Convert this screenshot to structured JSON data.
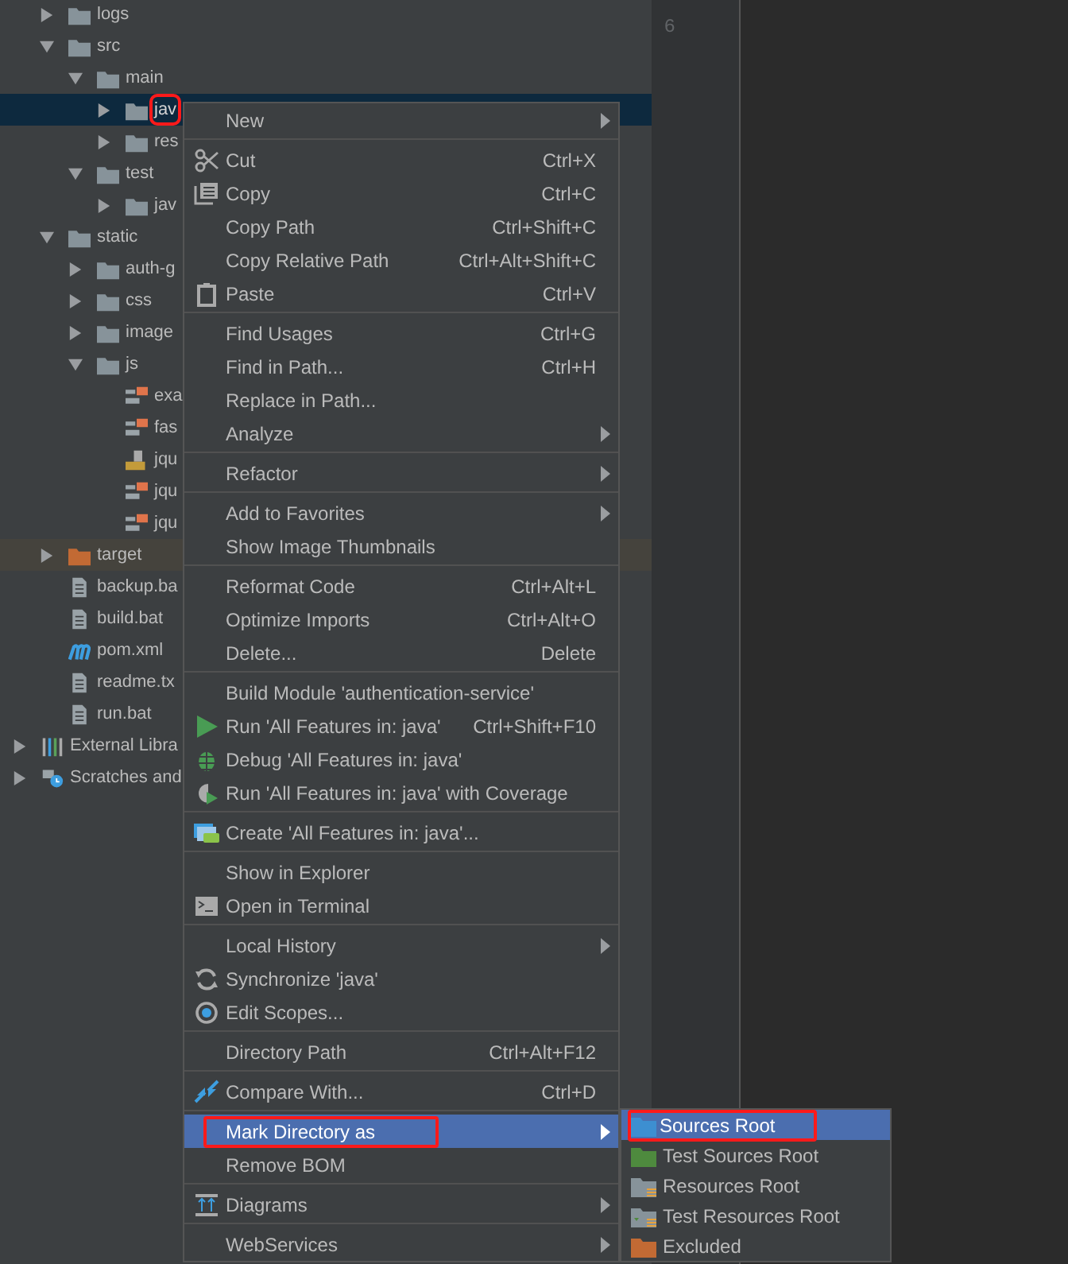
{
  "project_tree": [
    {
      "label": "logs",
      "kind": "folder",
      "expanded": false,
      "selected": false
    },
    {
      "label": "src",
      "kind": "folder",
      "expanded": true,
      "selected": false,
      "children": [
        {
          "label": "main",
          "kind": "folder",
          "expanded": true,
          "selected": false,
          "children": [
            {
              "label": "jav",
              "kind": "folder",
              "expanded": false,
              "selected": true,
              "annotated": true
            },
            {
              "label": "res",
              "kind": "folder",
              "expanded": false,
              "selected": false
            }
          ]
        },
        {
          "label": "test",
          "kind": "folder",
          "expanded": true,
          "selected": false,
          "children": [
            {
              "label": "jav",
              "kind": "folder",
              "expanded": false,
              "selected": false
            }
          ]
        }
      ]
    },
    {
      "label": "static",
      "kind": "folder",
      "expanded": true,
      "selected": false,
      "children": [
        {
          "label": "auth-g",
          "kind": "folder",
          "expanded": false,
          "selected": false
        },
        {
          "label": "css",
          "kind": "folder",
          "expanded": false,
          "selected": false
        },
        {
          "label": "image",
          "kind": "folder",
          "expanded": false,
          "selected": false
        },
        {
          "label": "js",
          "kind": "folder",
          "expanded": true,
          "selected": false,
          "children": [
            {
              "label": "exa",
              "kind": "js-min",
              "selected": false
            },
            {
              "label": "fas",
              "kind": "js-min",
              "selected": false
            },
            {
              "label": "jqu",
              "kind": "js-file",
              "selected": false
            },
            {
              "label": "jqu",
              "kind": "js-min",
              "selected": false
            },
            {
              "label": "jqu",
              "kind": "js-min",
              "selected": false
            }
          ]
        }
      ]
    },
    {
      "label": "target",
      "kind": "excluded-folder",
      "expanded": false,
      "selected": false
    },
    {
      "label": "backup.ba",
      "kind": "text-file",
      "selected": false
    },
    {
      "label": "build.bat",
      "kind": "text-file",
      "selected": false
    },
    {
      "label": "pom.xml",
      "kind": "maven-file",
      "selected": false
    },
    {
      "label": "readme.tx",
      "kind": "text-file",
      "selected": false
    },
    {
      "label": "run.bat",
      "kind": "text-file",
      "selected": false
    }
  ],
  "root_items": [
    {
      "label": "External Libra",
      "kind": "libraries",
      "expanded": false
    },
    {
      "label": "Scratches and",
      "kind": "scratches",
      "expanded": false
    }
  ],
  "editor": {
    "line_numbers": [
      "6"
    ]
  },
  "context_menu": {
    "groups": [
      [
        {
          "label": "New",
          "submenu": true
        }
      ],
      [
        {
          "label": "Cut",
          "shortcut": "Ctrl+X",
          "kind": "cut"
        },
        {
          "label": "Copy",
          "shortcut": "Ctrl+C",
          "kind": "copy"
        },
        {
          "label": "Copy Path",
          "shortcut": "Ctrl+Shift+C"
        },
        {
          "label": "Copy Relative Path",
          "shortcut": "Ctrl+Alt+Shift+C"
        },
        {
          "label": "Paste",
          "shortcut": "Ctrl+V",
          "kind": "paste"
        }
      ],
      [
        {
          "label": "Find Usages",
          "shortcut": "Ctrl+G"
        },
        {
          "label": "Find in Path...",
          "shortcut": "Ctrl+H"
        },
        {
          "label": "Replace in Path..."
        },
        {
          "label": "Analyze",
          "submenu": true
        }
      ],
      [
        {
          "label": "Refactor",
          "submenu": true
        }
      ],
      [
        {
          "label": "Add to Favorites",
          "submenu": true
        },
        {
          "label": "Show Image Thumbnails"
        }
      ],
      [
        {
          "label": "Reformat Code",
          "shortcut": "Ctrl+Alt+L"
        },
        {
          "label": "Optimize Imports",
          "shortcut": "Ctrl+Alt+O"
        },
        {
          "label": "Delete...",
          "shortcut": "Delete"
        }
      ],
      [
        {
          "label": "Build Module 'authentication-service'"
        },
        {
          "label": "Run 'All Features in: java'",
          "shortcut": "Ctrl+Shift+F10",
          "kind": "run"
        },
        {
          "label": "Debug 'All Features in: java'",
          "kind": "debug"
        },
        {
          "label": "Run 'All Features in: java' with Coverage",
          "kind": "coverage"
        }
      ],
      [
        {
          "label": "Create 'All Features in: java'...",
          "kind": "create"
        }
      ],
      [
        {
          "label": "Show in Explorer"
        },
        {
          "label": "Open in Terminal",
          "kind": "terminal"
        }
      ],
      [
        {
          "label": "Local History",
          "submenu": true
        },
        {
          "label": "Synchronize 'java'",
          "kind": "sync"
        },
        {
          "label": "Edit Scopes...",
          "kind": "scopes"
        }
      ],
      [
        {
          "label": "Directory Path",
          "shortcut": "Ctrl+Alt+F12"
        }
      ],
      [
        {
          "label": "Compare With...",
          "shortcut": "Ctrl+D",
          "kind": "compare"
        }
      ],
      [
        {
          "label": "Mark Directory as",
          "submenu": true,
          "selected": true,
          "annotated": true
        },
        {
          "label": "Remove BOM"
        }
      ],
      [
        {
          "label": "Diagrams",
          "submenu": true,
          "kind": "diagrams"
        }
      ],
      [
        {
          "label": "WebServices",
          "submenu": true
        }
      ]
    ]
  },
  "submenu": {
    "items": [
      {
        "label": "Sources Root",
        "kind": "sources",
        "selected": true,
        "annotated": true
      },
      {
        "label": "Test Sources Root",
        "kind": "test-sources",
        "selected": false
      },
      {
        "label": "Resources Root",
        "kind": "resources",
        "selected": false
      },
      {
        "label": "Test Resources Root",
        "kind": "test-resources",
        "selected": false
      },
      {
        "label": "Excluded",
        "kind": "excluded",
        "selected": false
      }
    ]
  }
}
